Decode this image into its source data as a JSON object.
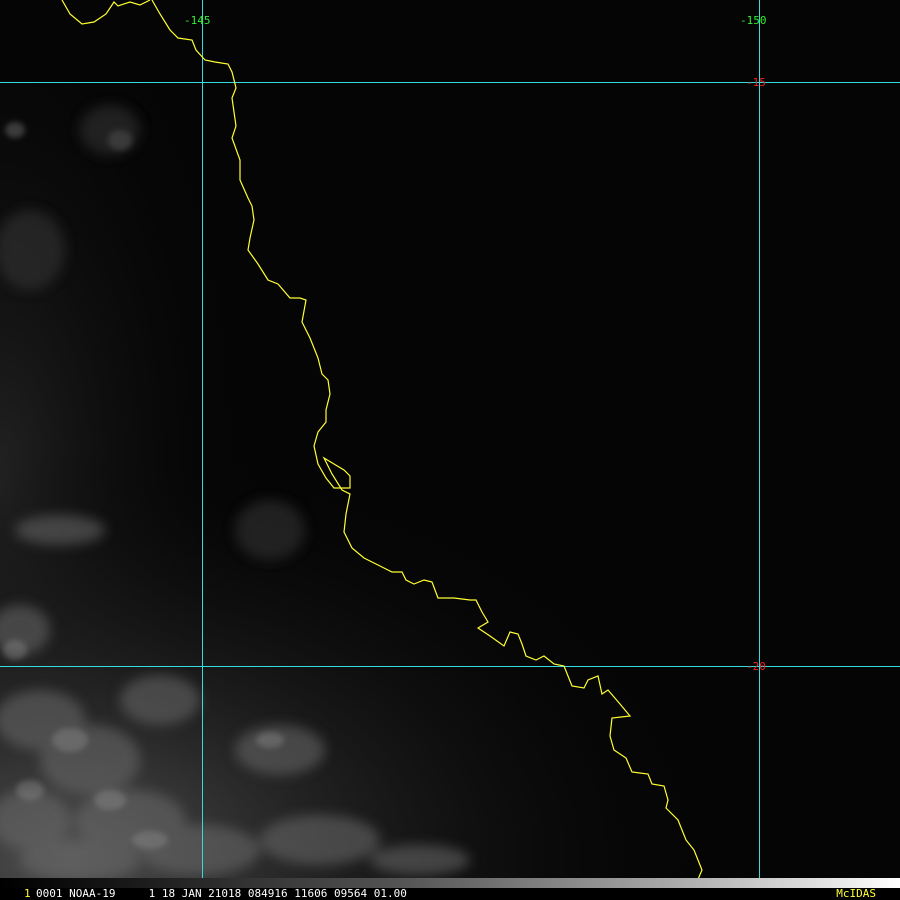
{
  "map": {
    "longitude_labels": [
      "-145",
      "-150"
    ],
    "latitude_labels": [
      "-15",
      "-20"
    ],
    "colors": {
      "background": "#050505",
      "graticule": "#33dddd",
      "coastline": "#ffff33",
      "longitude_label": "#33ee33",
      "latitude_label": "#ee2222"
    }
  },
  "footer": {
    "frame_number": "1",
    "info": "0001 NOAA-19     1 18 JAN 21018 084916 11606 09564 01.00",
    "brand": "McIDAS"
  }
}
